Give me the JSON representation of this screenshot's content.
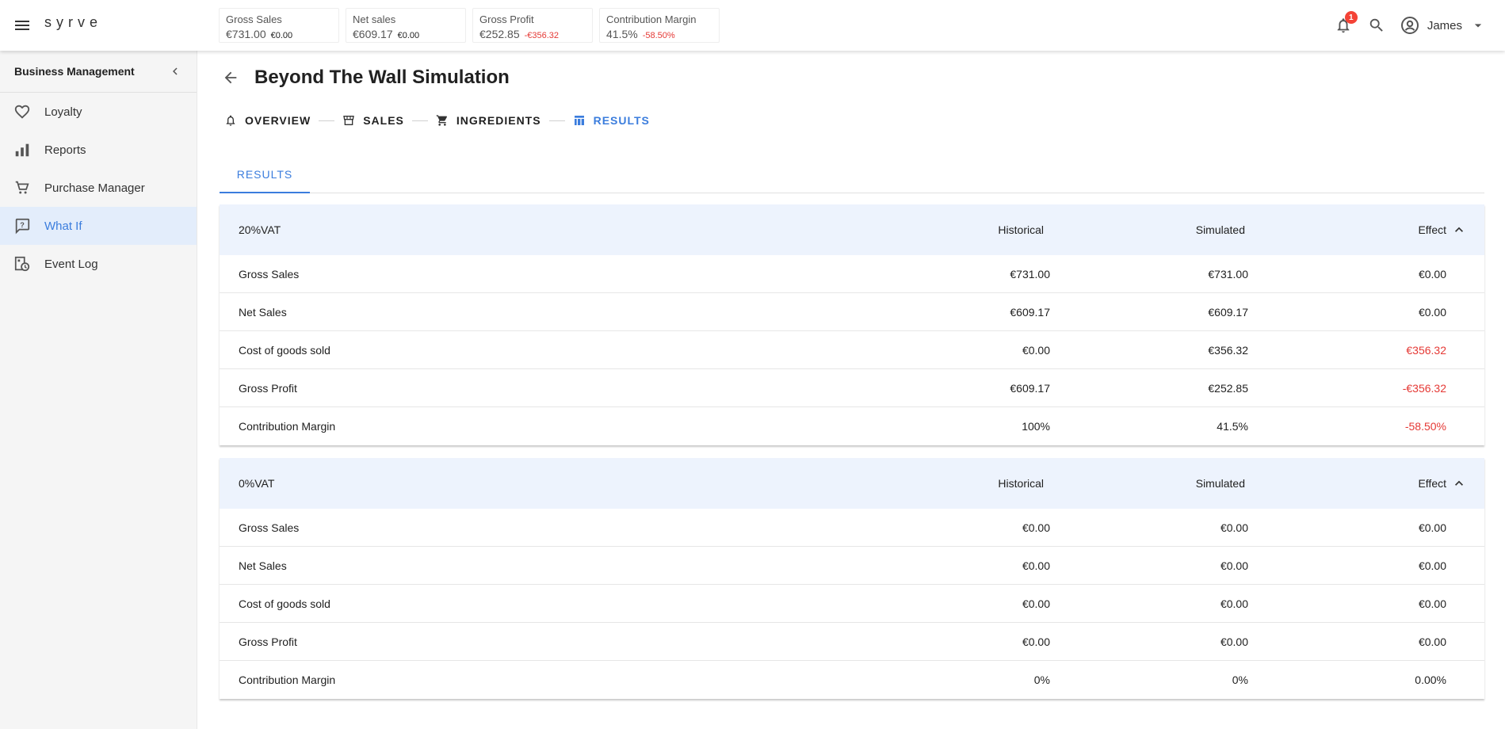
{
  "app": {
    "logo": "syrve"
  },
  "kpis": [
    {
      "label": "Gross Sales",
      "value": "€731.00",
      "delta": "€0.00",
      "negative": false
    },
    {
      "label": "Net sales",
      "value": "€609.17",
      "delta": "€0.00",
      "negative": false
    },
    {
      "label": "Gross Profit",
      "value": "€252.85",
      "delta": "-€356.32",
      "negative": true
    },
    {
      "label": "Contribution Margin",
      "value": "41.5%",
      "delta": "-58.50%",
      "negative": true
    }
  ],
  "topbar": {
    "notification_count": "1",
    "user_name": "James"
  },
  "sidebar": {
    "title": "Business Management",
    "items": [
      {
        "label": "Loyalty",
        "icon": "heart-icon"
      },
      {
        "label": "Reports",
        "icon": "bar-chart-icon"
      },
      {
        "label": "Purchase Manager",
        "icon": "cart-icon"
      },
      {
        "label": "What If",
        "icon": "question-chat-icon",
        "active": true
      },
      {
        "label": "Event Log",
        "icon": "clock-log-icon"
      }
    ]
  },
  "page": {
    "title": "Beyond The Wall Simulation"
  },
  "stepper": [
    {
      "label": "OVERVIEW",
      "icon": "bell-icon"
    },
    {
      "label": "SALES",
      "icon": "store-icon"
    },
    {
      "label": "INGREDIENTS",
      "icon": "cart-icon"
    },
    {
      "label": "RESULTS",
      "icon": "table-icon",
      "active": true
    }
  ],
  "tabs": {
    "results": "RESULTS"
  },
  "columns": {
    "historical": "Historical",
    "simulated": "Simulated",
    "effect": "Effect"
  },
  "tables": [
    {
      "title": "20%VAT",
      "rows": [
        {
          "label": "Gross Sales",
          "historical": "€731.00",
          "simulated": "€731.00",
          "effect": "€0.00",
          "negative": false
        },
        {
          "label": "Net Sales",
          "historical": "€609.17",
          "simulated": "€609.17",
          "effect": "€0.00",
          "negative": false
        },
        {
          "label": "Cost of goods sold",
          "historical": "€0.00",
          "simulated": "€356.32",
          "effect": "€356.32",
          "negative": true
        },
        {
          "label": "Gross Profit",
          "historical": "€609.17",
          "simulated": "€252.85",
          "effect": "-€356.32",
          "negative": true
        },
        {
          "label": "Contribution Margin",
          "historical": "100%",
          "simulated": "41.5%",
          "effect": "-58.50%",
          "negative": true
        }
      ]
    },
    {
      "title": "0%VAT",
      "rows": [
        {
          "label": "Gross Sales",
          "historical": "€0.00",
          "simulated": "€0.00",
          "effect": "€0.00",
          "negative": false
        },
        {
          "label": "Net Sales",
          "historical": "€0.00",
          "simulated": "€0.00",
          "effect": "€0.00",
          "negative": false
        },
        {
          "label": "Cost of goods sold",
          "historical": "€0.00",
          "simulated": "€0.00",
          "effect": "€0.00",
          "negative": false
        },
        {
          "label": "Gross Profit",
          "historical": "€0.00",
          "simulated": "€0.00",
          "effect": "€0.00",
          "negative": false
        },
        {
          "label": "Contribution Margin",
          "historical": "0%",
          "simulated": "0%",
          "effect": "0.00%",
          "negative": false
        }
      ]
    }
  ],
  "colors": {
    "accent": "#3b7ddd",
    "negative": "#e53935",
    "header_bg": "#edf3fd",
    "active_nav_bg": "#e3edfb"
  }
}
